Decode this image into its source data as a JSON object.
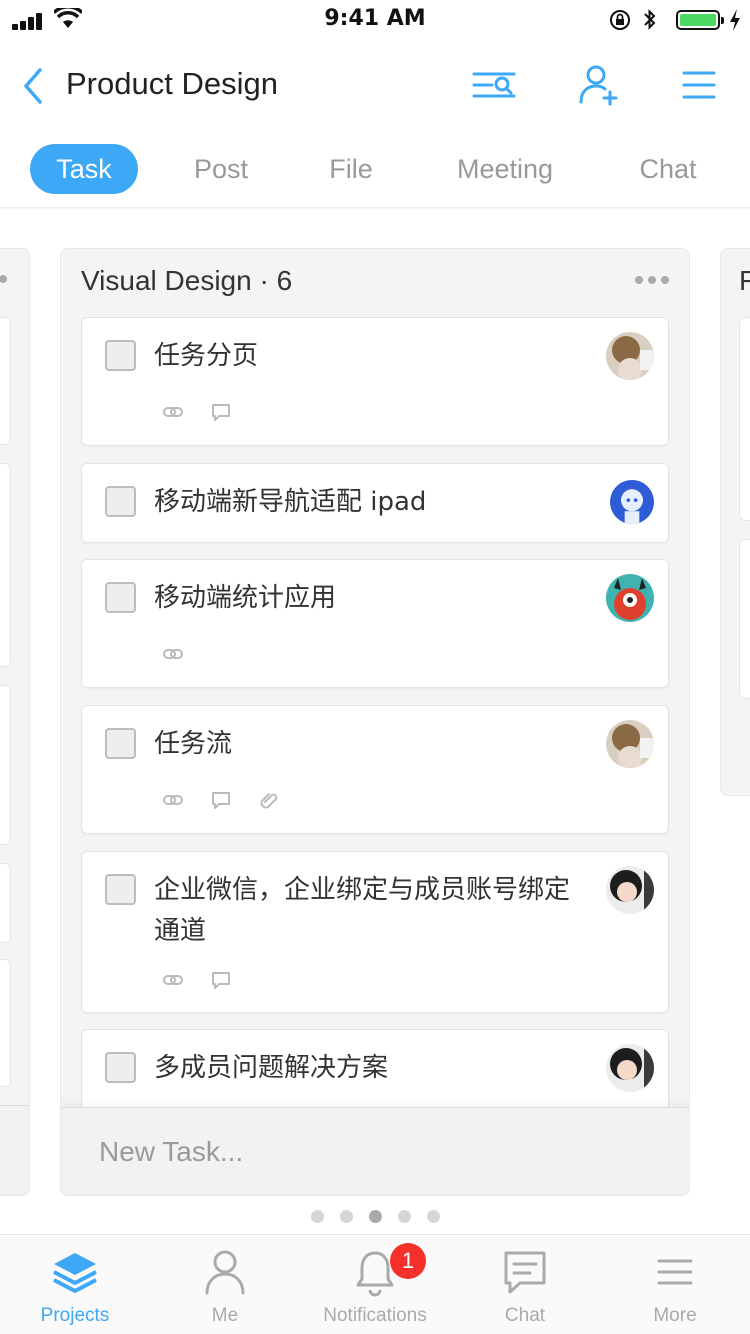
{
  "status_bar": {
    "time": "9:41 AM"
  },
  "header": {
    "title": "Product Design",
    "back_icon": "chevron-left-icon",
    "filter_icon": "filter-search-icon",
    "add_member_icon": "add-user-icon",
    "menu_icon": "menu-icon"
  },
  "tabs": [
    {
      "label": "Task",
      "active": true
    },
    {
      "label": "Post",
      "active": false
    },
    {
      "label": "File",
      "active": false
    },
    {
      "label": "Meeting",
      "active": false
    },
    {
      "label": "Chat",
      "active": false
    }
  ],
  "board": {
    "column": {
      "title": "Visual Design · 6",
      "cards": [
        {
          "title": "任务分页",
          "icons": [
            "link-icon",
            "comment-icon"
          ],
          "avatar": "avatar-1"
        },
        {
          "title": "移动端新导航适配 ipad",
          "icons": [],
          "avatar": "avatar-2"
        },
        {
          "title": "移动端统计应用",
          "icons": [
            "link-icon"
          ],
          "avatar": "avatar-3"
        },
        {
          "title": "任务流",
          "icons": [
            "link-icon",
            "comment-icon",
            "attachment-icon"
          ],
          "avatar": "avatar-1"
        },
        {
          "title": "企业微信，企业绑定与成员账号绑定通道",
          "icons": [
            "link-icon",
            "comment-icon"
          ],
          "avatar": "avatar-4"
        },
        {
          "title": "多成员问题解决方案",
          "icons": [],
          "avatar": "avatar-4"
        }
      ],
      "new_task_placeholder": "New Task..."
    },
    "next_column_title_initial": "F",
    "page_dots": 5,
    "active_dot": 2
  },
  "bottom_nav": [
    {
      "label": "Projects",
      "icon": "layers-icon",
      "active": true
    },
    {
      "label": "Me",
      "icon": "user-icon",
      "active": false
    },
    {
      "label": "Notifications",
      "icon": "bell-icon",
      "active": false,
      "badge": "1"
    },
    {
      "label": "Chat",
      "icon": "chat-icon",
      "active": false
    },
    {
      "label": "More",
      "icon": "menu-icon",
      "active": false
    }
  ],
  "colors": {
    "accent": "#3da8f5",
    "badge": "#f5302b",
    "battery": "#4cd964"
  }
}
